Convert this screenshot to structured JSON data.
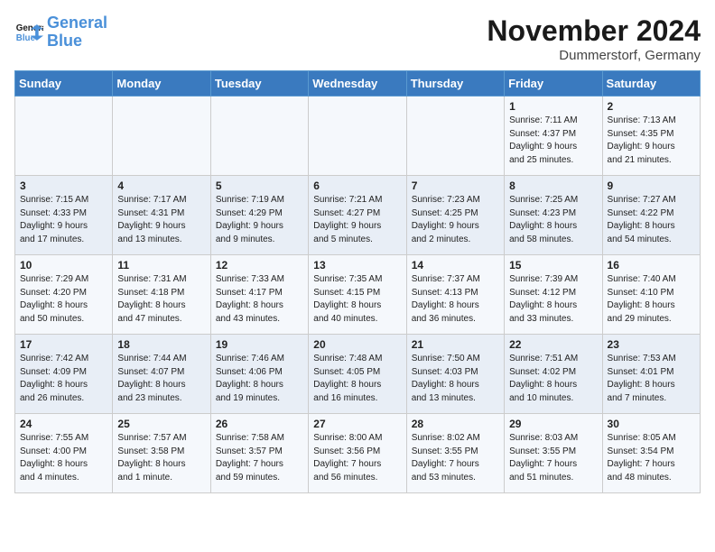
{
  "header": {
    "logo_line1": "General",
    "logo_line2": "Blue",
    "month": "November 2024",
    "location": "Dummerstorf, Germany"
  },
  "days_of_week": [
    "Sunday",
    "Monday",
    "Tuesday",
    "Wednesday",
    "Thursday",
    "Friday",
    "Saturday"
  ],
  "weeks": [
    [
      {
        "day": "",
        "info": ""
      },
      {
        "day": "",
        "info": ""
      },
      {
        "day": "",
        "info": ""
      },
      {
        "day": "",
        "info": ""
      },
      {
        "day": "",
        "info": ""
      },
      {
        "day": "1",
        "info": "Sunrise: 7:11 AM\nSunset: 4:37 PM\nDaylight: 9 hours\nand 25 minutes."
      },
      {
        "day": "2",
        "info": "Sunrise: 7:13 AM\nSunset: 4:35 PM\nDaylight: 9 hours\nand 21 minutes."
      }
    ],
    [
      {
        "day": "3",
        "info": "Sunrise: 7:15 AM\nSunset: 4:33 PM\nDaylight: 9 hours\nand 17 minutes."
      },
      {
        "day": "4",
        "info": "Sunrise: 7:17 AM\nSunset: 4:31 PM\nDaylight: 9 hours\nand 13 minutes."
      },
      {
        "day": "5",
        "info": "Sunrise: 7:19 AM\nSunset: 4:29 PM\nDaylight: 9 hours\nand 9 minutes."
      },
      {
        "day": "6",
        "info": "Sunrise: 7:21 AM\nSunset: 4:27 PM\nDaylight: 9 hours\nand 5 minutes."
      },
      {
        "day": "7",
        "info": "Sunrise: 7:23 AM\nSunset: 4:25 PM\nDaylight: 9 hours\nand 2 minutes."
      },
      {
        "day": "8",
        "info": "Sunrise: 7:25 AM\nSunset: 4:23 PM\nDaylight: 8 hours\nand 58 minutes."
      },
      {
        "day": "9",
        "info": "Sunrise: 7:27 AM\nSunset: 4:22 PM\nDaylight: 8 hours\nand 54 minutes."
      }
    ],
    [
      {
        "day": "10",
        "info": "Sunrise: 7:29 AM\nSunset: 4:20 PM\nDaylight: 8 hours\nand 50 minutes."
      },
      {
        "day": "11",
        "info": "Sunrise: 7:31 AM\nSunset: 4:18 PM\nDaylight: 8 hours\nand 47 minutes."
      },
      {
        "day": "12",
        "info": "Sunrise: 7:33 AM\nSunset: 4:17 PM\nDaylight: 8 hours\nand 43 minutes."
      },
      {
        "day": "13",
        "info": "Sunrise: 7:35 AM\nSunset: 4:15 PM\nDaylight: 8 hours\nand 40 minutes."
      },
      {
        "day": "14",
        "info": "Sunrise: 7:37 AM\nSunset: 4:13 PM\nDaylight: 8 hours\nand 36 minutes."
      },
      {
        "day": "15",
        "info": "Sunrise: 7:39 AM\nSunset: 4:12 PM\nDaylight: 8 hours\nand 33 minutes."
      },
      {
        "day": "16",
        "info": "Sunrise: 7:40 AM\nSunset: 4:10 PM\nDaylight: 8 hours\nand 29 minutes."
      }
    ],
    [
      {
        "day": "17",
        "info": "Sunrise: 7:42 AM\nSunset: 4:09 PM\nDaylight: 8 hours\nand 26 minutes."
      },
      {
        "day": "18",
        "info": "Sunrise: 7:44 AM\nSunset: 4:07 PM\nDaylight: 8 hours\nand 23 minutes."
      },
      {
        "day": "19",
        "info": "Sunrise: 7:46 AM\nSunset: 4:06 PM\nDaylight: 8 hours\nand 19 minutes."
      },
      {
        "day": "20",
        "info": "Sunrise: 7:48 AM\nSunset: 4:05 PM\nDaylight: 8 hours\nand 16 minutes."
      },
      {
        "day": "21",
        "info": "Sunrise: 7:50 AM\nSunset: 4:03 PM\nDaylight: 8 hours\nand 13 minutes."
      },
      {
        "day": "22",
        "info": "Sunrise: 7:51 AM\nSunset: 4:02 PM\nDaylight: 8 hours\nand 10 minutes."
      },
      {
        "day": "23",
        "info": "Sunrise: 7:53 AM\nSunset: 4:01 PM\nDaylight: 8 hours\nand 7 minutes."
      }
    ],
    [
      {
        "day": "24",
        "info": "Sunrise: 7:55 AM\nSunset: 4:00 PM\nDaylight: 8 hours\nand 4 minutes."
      },
      {
        "day": "25",
        "info": "Sunrise: 7:57 AM\nSunset: 3:58 PM\nDaylight: 8 hours\nand 1 minute."
      },
      {
        "day": "26",
        "info": "Sunrise: 7:58 AM\nSunset: 3:57 PM\nDaylight: 7 hours\nand 59 minutes."
      },
      {
        "day": "27",
        "info": "Sunrise: 8:00 AM\nSunset: 3:56 PM\nDaylight: 7 hours\nand 56 minutes."
      },
      {
        "day": "28",
        "info": "Sunrise: 8:02 AM\nSunset: 3:55 PM\nDaylight: 7 hours\nand 53 minutes."
      },
      {
        "day": "29",
        "info": "Sunrise: 8:03 AM\nSunset: 3:55 PM\nDaylight: 7 hours\nand 51 minutes."
      },
      {
        "day": "30",
        "info": "Sunrise: 8:05 AM\nSunset: 3:54 PM\nDaylight: 7 hours\nand 48 minutes."
      }
    ]
  ]
}
